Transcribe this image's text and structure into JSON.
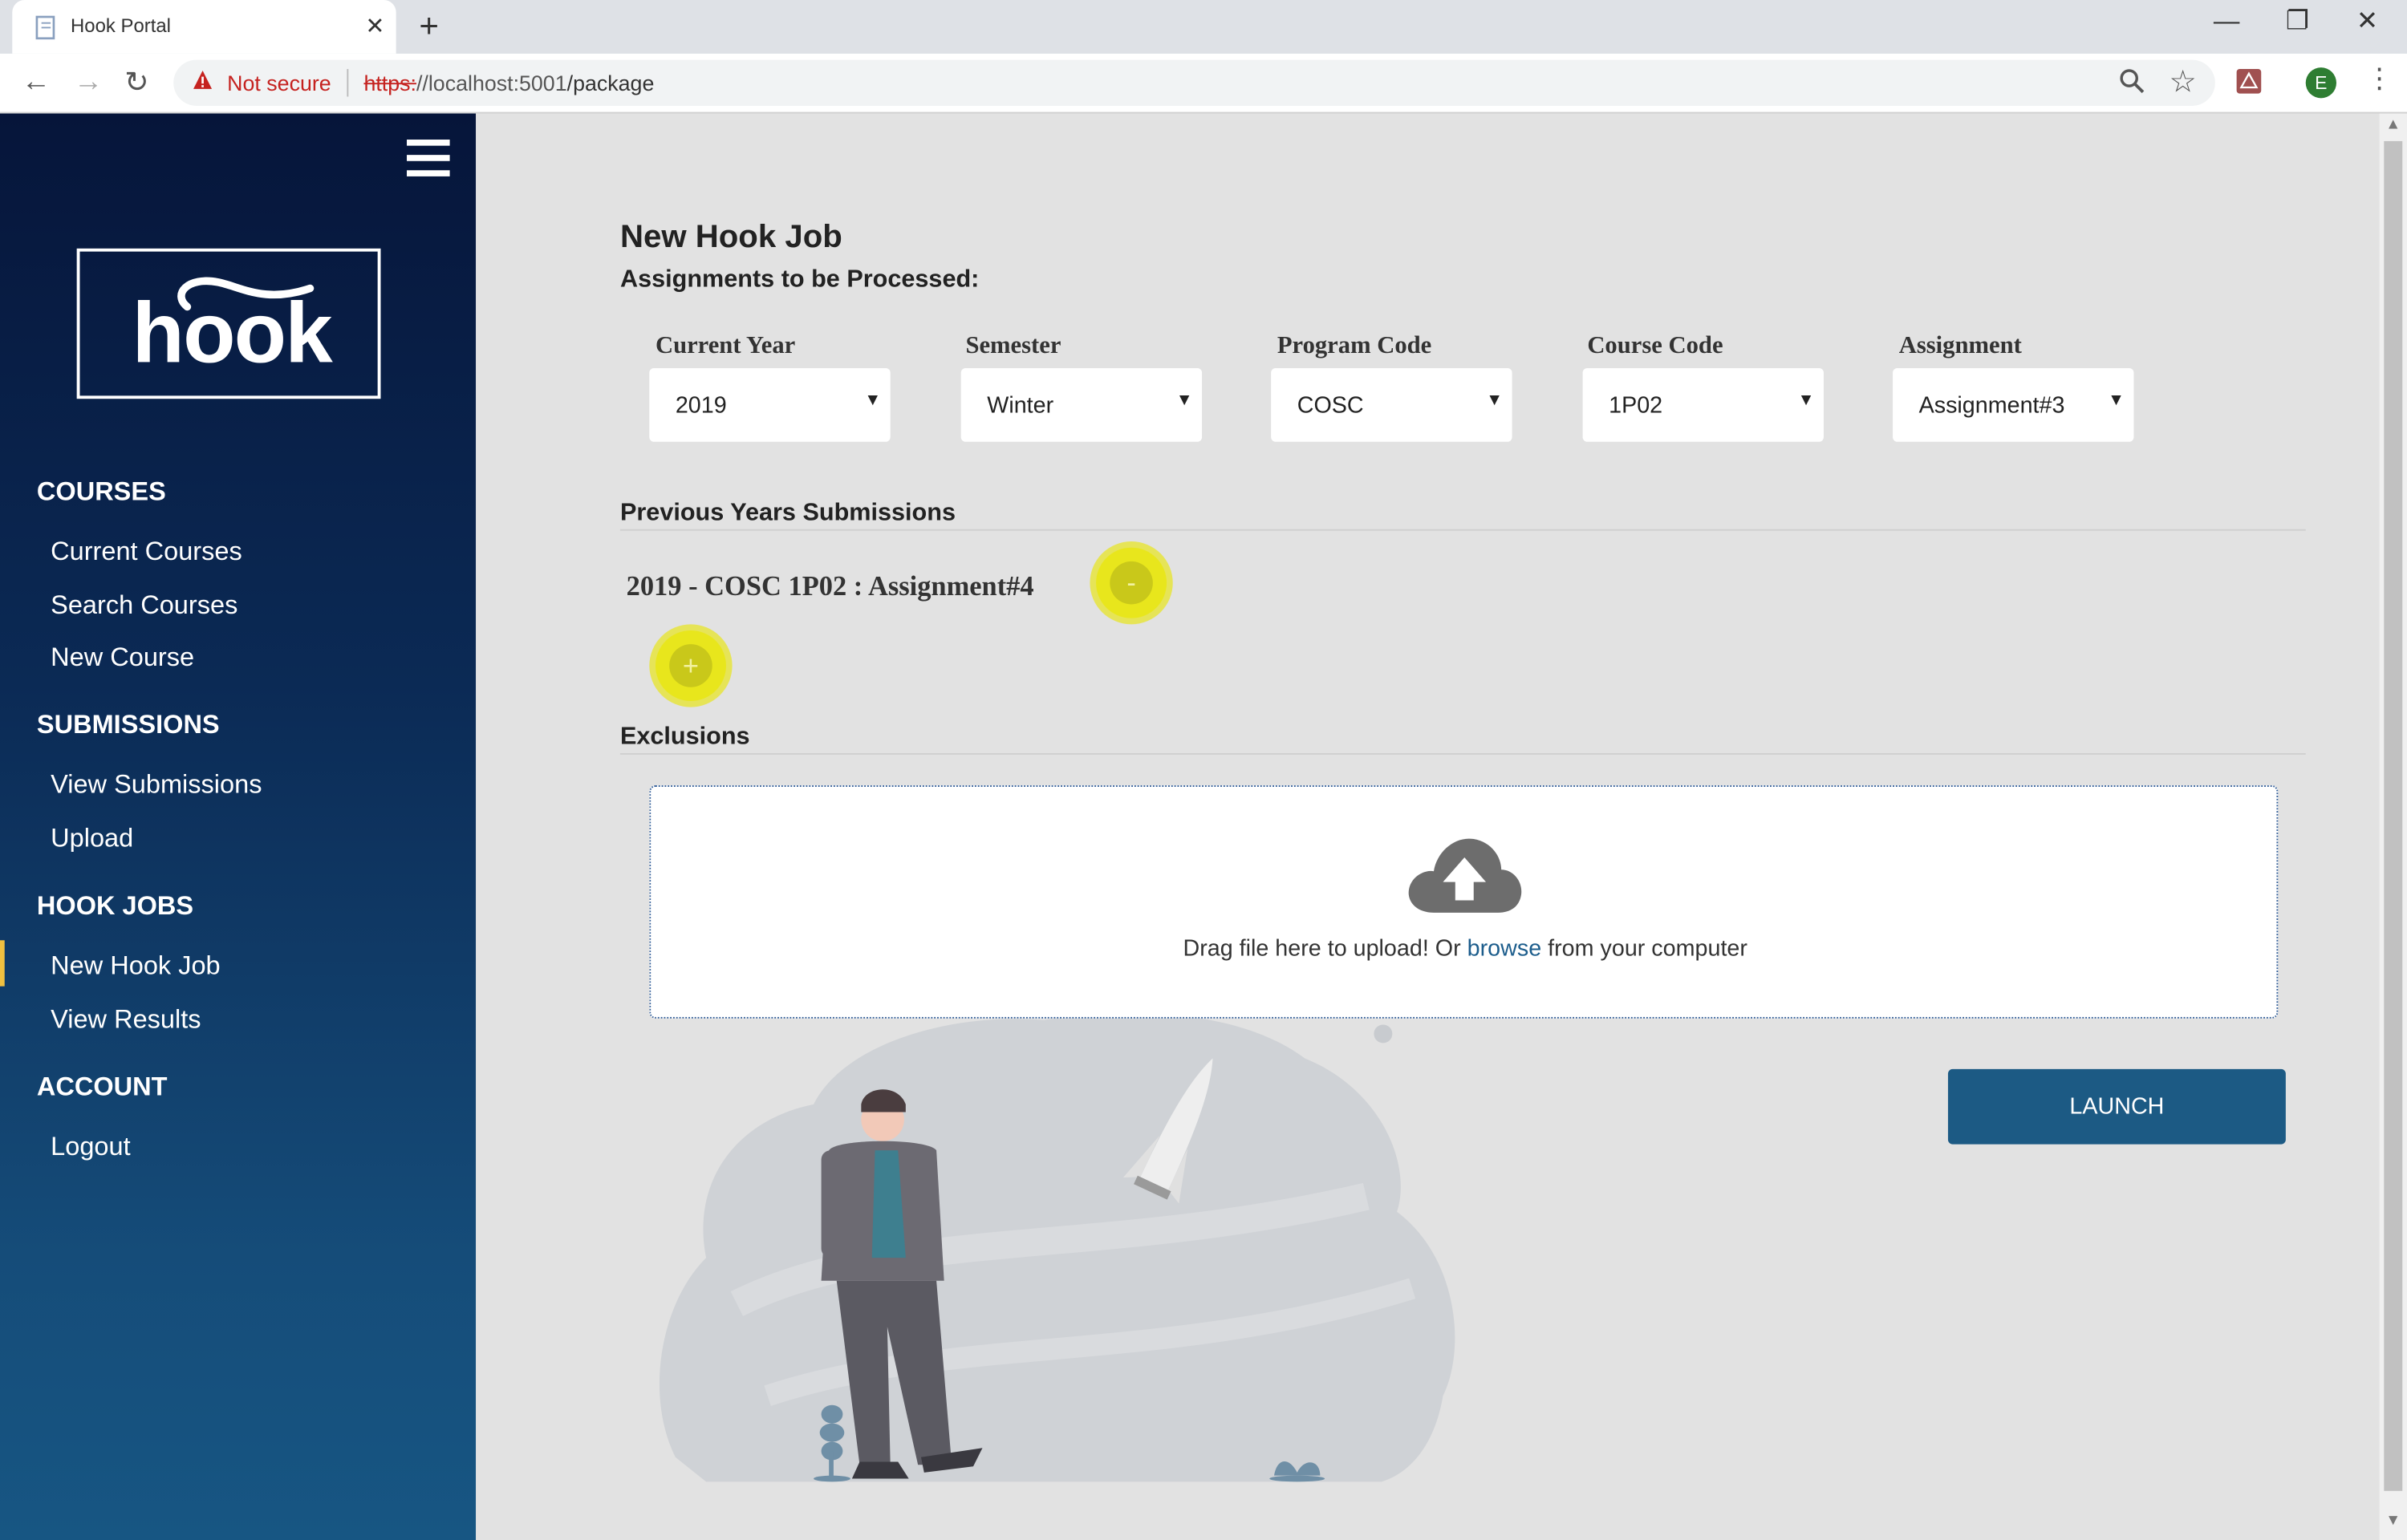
{
  "browser": {
    "tab_title": "Hook Portal",
    "tab_close": "✕",
    "new_tab": "+",
    "security_label": "Not secure",
    "url_scheme": "https:",
    "url_host": "//localhost:5001",
    "url_path": "/package",
    "profile_initial": "E"
  },
  "sidebar": {
    "logo_text": "hook",
    "sections": [
      {
        "heading": "COURSES",
        "items": [
          "Current Courses",
          "Search Courses",
          "New Course"
        ]
      },
      {
        "heading": "SUBMISSIONS",
        "items": [
          "View Submissions",
          "Upload"
        ]
      },
      {
        "heading": "HOOK JOBS",
        "items": [
          "New Hook Job",
          "View Results"
        ]
      },
      {
        "heading": "ACCOUNT",
        "items": [
          "Logout"
        ]
      }
    ],
    "active_item": "New Hook Job"
  },
  "page": {
    "title": "New Hook Job",
    "subtitle": "Assignments to be Processed:",
    "fields": [
      {
        "label": "Current Year",
        "value": "2019"
      },
      {
        "label": "Semester",
        "value": "Winter"
      },
      {
        "label": "Program Code",
        "value": "COSC"
      },
      {
        "label": "Course Code",
        "value": "1P02"
      },
      {
        "label": "Assignment",
        "value": "Assignment#3"
      }
    ],
    "previous_title": "Previous Years Submissions",
    "previous_entry": "2019 - COSC 1P02 : Assignment#4",
    "remove_symbol": "-",
    "add_symbol": "+",
    "exclusions_title": "Exclusions",
    "upload_text_before": "Drag file here to upload! Or ",
    "upload_browse": "browse",
    "upload_text_after": " from your computer",
    "launch_label": "LAUNCH"
  },
  "colors": {
    "sidebar_top": "#06153a",
    "sidebar_bottom": "#175683",
    "accent": "#1c5a84",
    "highlight": "#e8e61c"
  }
}
